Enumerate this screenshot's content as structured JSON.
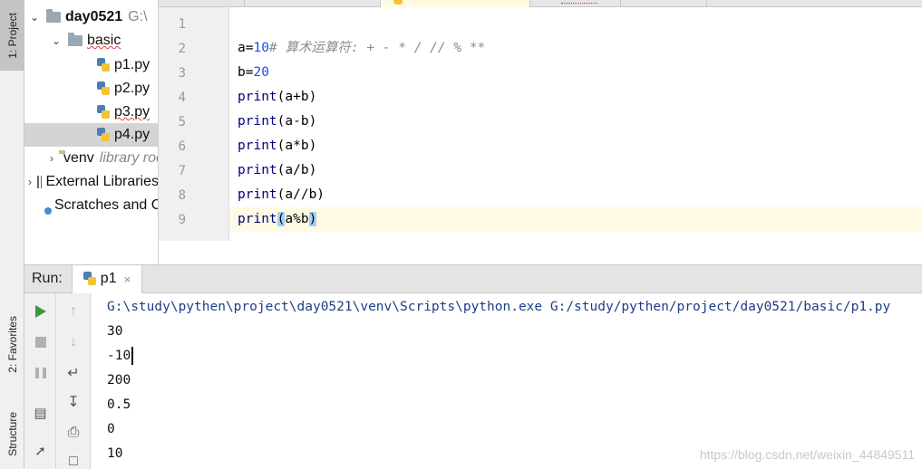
{
  "tool_windows": {
    "project": "1: Project",
    "favorites": "2: Favorites",
    "structure": "Structure"
  },
  "project_tree": {
    "root": {
      "name": "day0521",
      "path": "G:\\"
    },
    "basic": "basic",
    "files": [
      "p1.py",
      "p2.py",
      "p3.py",
      "p4.py"
    ],
    "venv": {
      "name": "venv",
      "hint": "library root"
    },
    "external": "External Libraries",
    "scratches": "Scratches and Consoles"
  },
  "editor": {
    "line_numbers": [
      "1",
      "2",
      "3",
      "4",
      "5",
      "6",
      "7",
      "8",
      "9"
    ],
    "comment": "# 算术运算符: + - * / // % **",
    "lines": {
      "l2": {
        "var": "a",
        "op": "=",
        "num": "10"
      },
      "l3": {
        "var": "b",
        "op": "=",
        "num": "20"
      },
      "print": "print",
      "args": [
        "(a+b)",
        "(a-b)",
        "(a*b)",
        "(a/b)",
        "(a//b)"
      ],
      "l9": {
        "open": "(",
        "inner": "a%b",
        "close": ")"
      }
    }
  },
  "run": {
    "label": "Run:",
    "tab": "p1",
    "close": "×",
    "command": "G:\\study\\pythen\\project\\day0521\\venv\\Scripts\\python.exe G:/study/pythen/project/day0521/basic/p1.py",
    "output": [
      "30",
      "-10",
      "200",
      "0.5",
      "0",
      "10"
    ]
  },
  "watermark": "https://blog.csdn.net/weixin_44849511"
}
